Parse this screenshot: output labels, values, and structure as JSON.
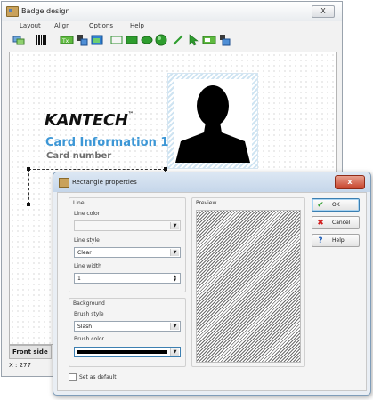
{
  "window": {
    "title": "Badge design",
    "close_label": "X"
  },
  "menu": [
    {
      "label": "Layout"
    },
    {
      "label": "Align"
    },
    {
      "label": "Options"
    },
    {
      "label": "Help"
    }
  ],
  "toolbar": {
    "tools": [
      "select-cards-icon",
      "barcode-icon",
      "text-icon",
      "stamp-icon",
      "image-icon",
      "rectangle-icon",
      "ellipse-icon",
      "sphere-icon",
      "line-icon",
      "pointer-icon",
      "text-field-icon",
      "layers-icon"
    ]
  },
  "badge": {
    "logo": "KANTECH",
    "logo_mark": "™",
    "card_info": "Card Information 1",
    "card_number": "Card number"
  },
  "side": {
    "tab_label": "Front side"
  },
  "status": {
    "coords": "X : 277"
  },
  "dialog": {
    "title": "Rectangle properties",
    "close_label": "x",
    "line": {
      "group_title": "Line",
      "color_label": "Line color",
      "color_value": "",
      "style_label": "Line style",
      "style_value": "Clear",
      "width_label": "Line width",
      "width_value": "1"
    },
    "background": {
      "group_title": "Background",
      "brush_style_label": "Brush style",
      "brush_style_value": "Slash",
      "brush_color_label": "Brush color",
      "brush_color_value": "#000000"
    },
    "preview_label": "Preview",
    "set_default_label": "Set as default",
    "buttons": {
      "ok": "OK",
      "cancel": "Cancel",
      "help": "Help"
    },
    "colors": {
      "ok_check": "#2e9d2e",
      "cancel_x": "#d11d1d",
      "help_icon": "#1f5fb8"
    }
  }
}
